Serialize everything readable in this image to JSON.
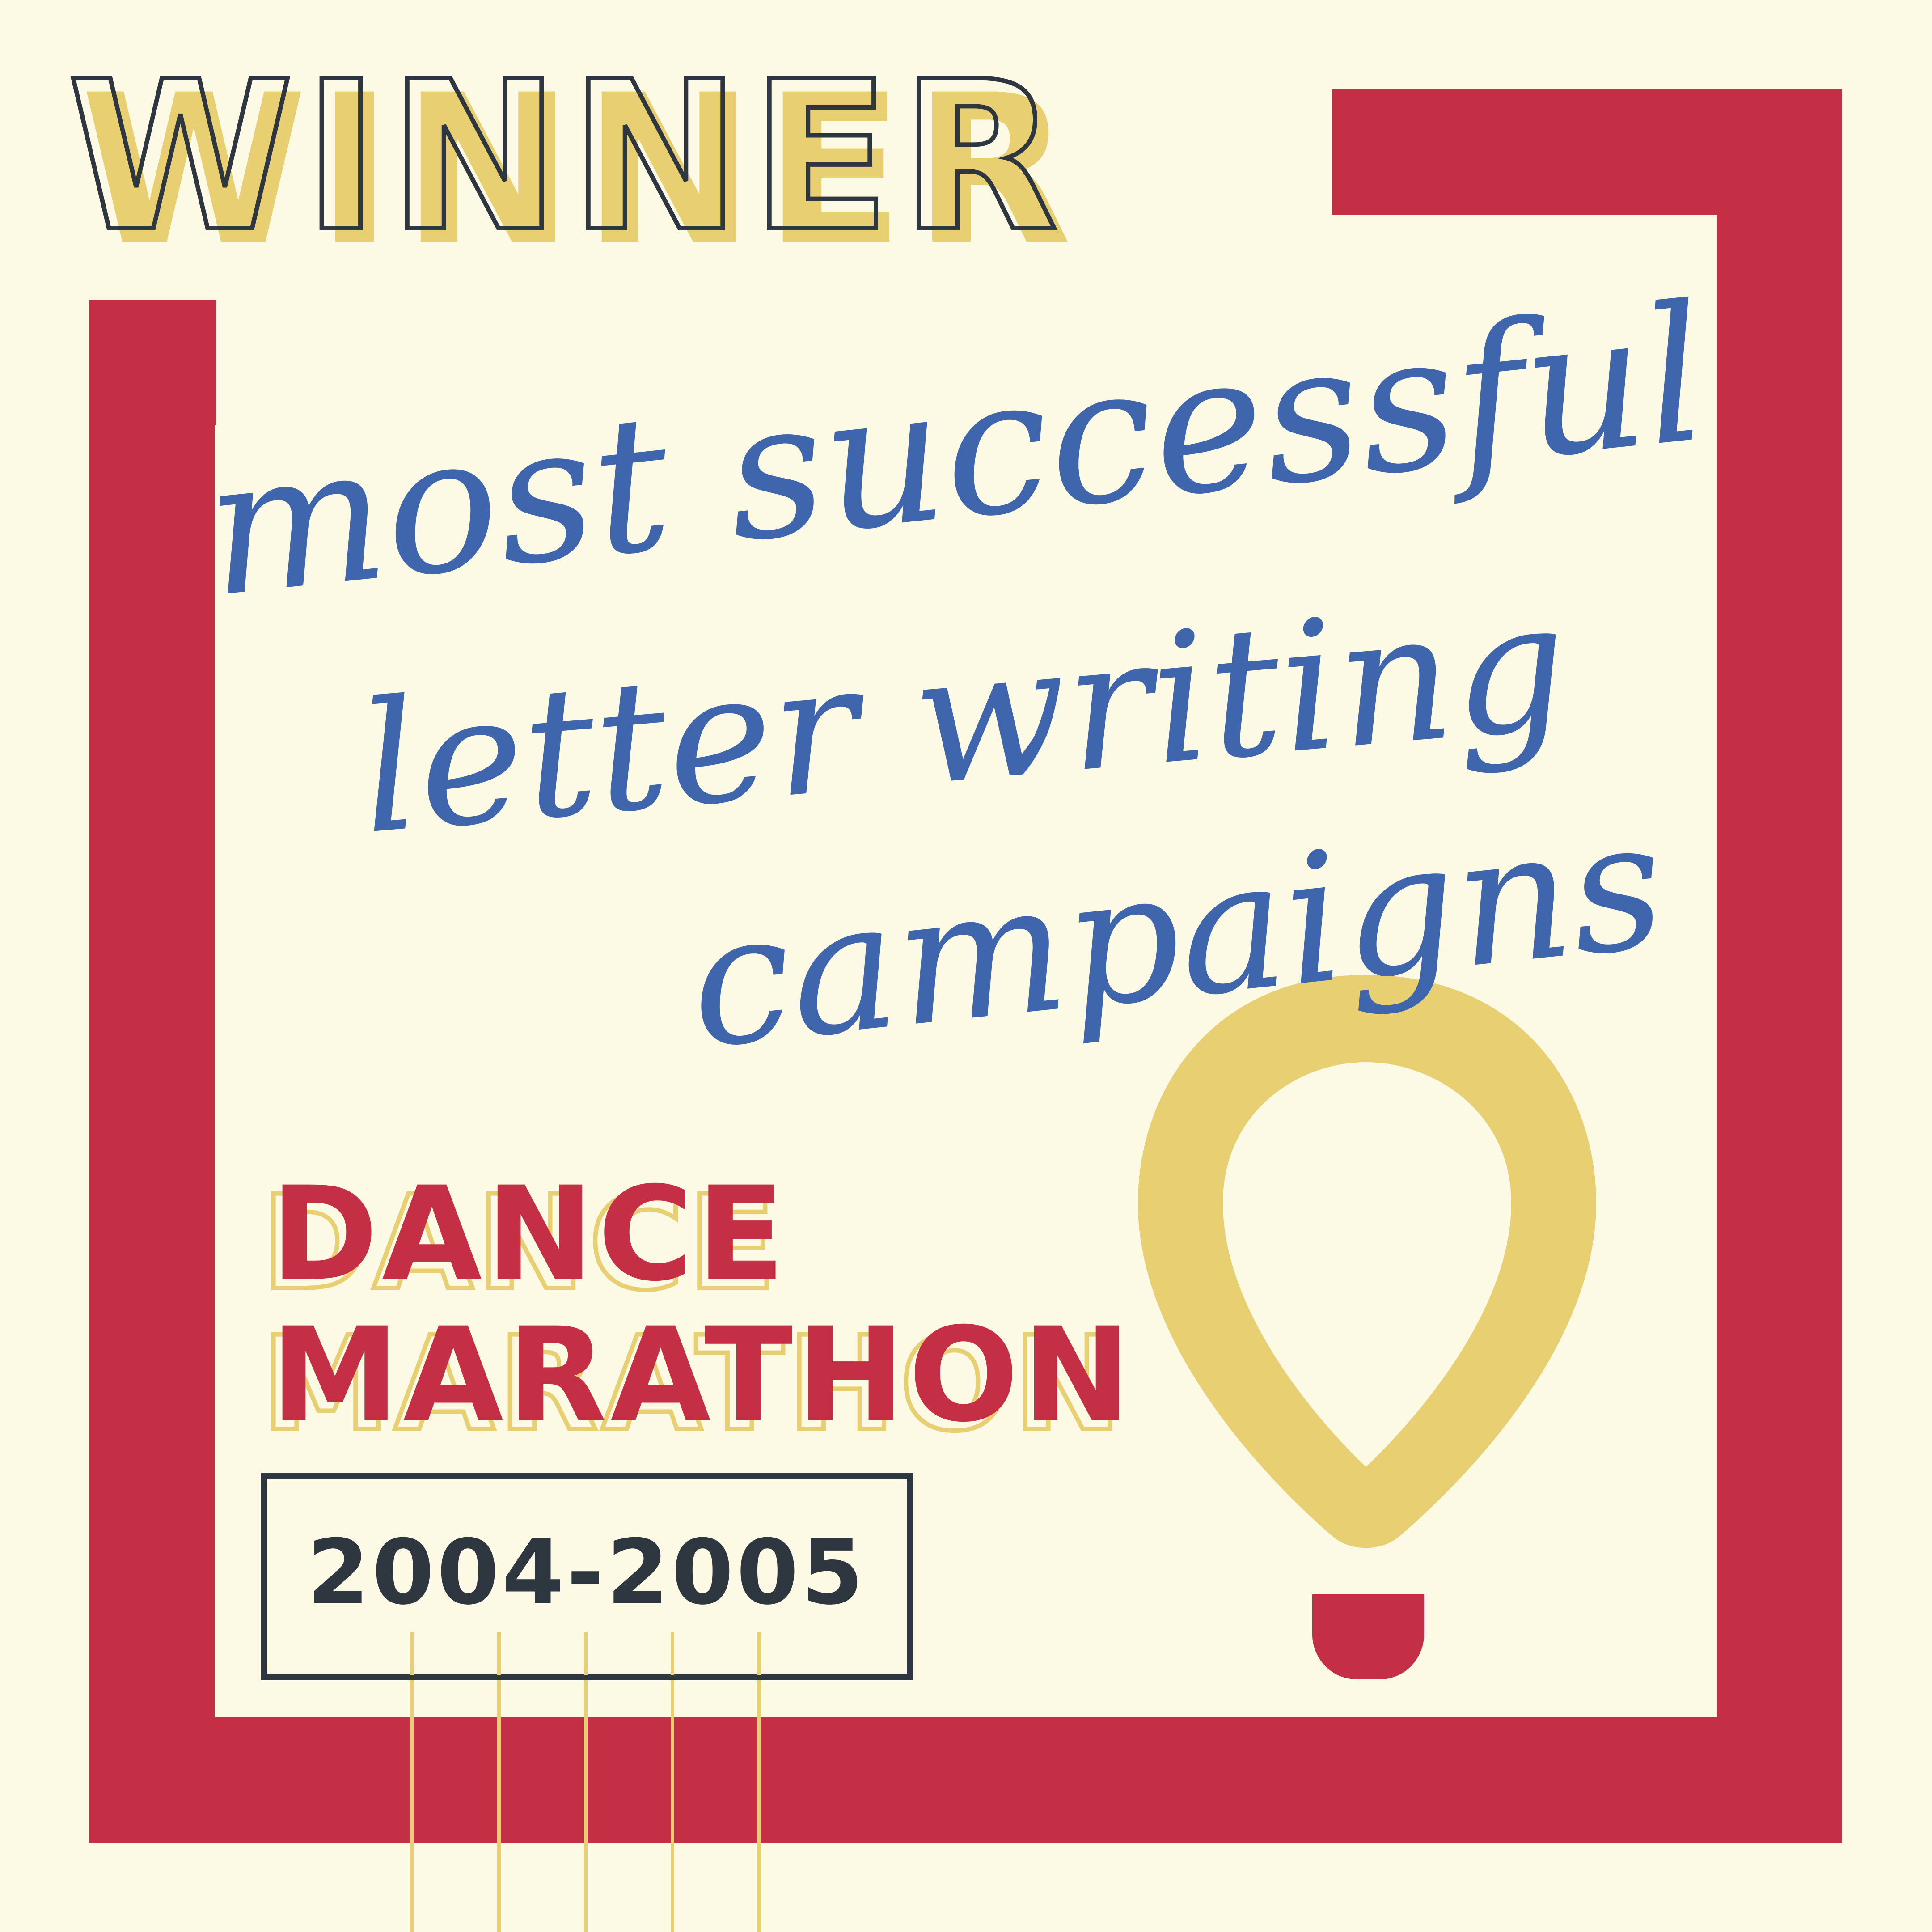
{
  "badge": {
    "winner_word": "WINNER",
    "award_line_1": "most successful",
    "award_line_2": "letter writing",
    "award_line_3": "campaigns",
    "event_line_1": "DANCE",
    "event_line_2": "MARATHON",
    "years": "2004-2005"
  },
  "colors": {
    "background": "#fcf9e4",
    "frame_red": "#c42f46",
    "gold": "#e8cf72",
    "script_blue": "#3f66ad",
    "dark": "#2e3640",
    "outline_fill": "#fcf9e4"
  },
  "icons": {
    "balloon": "hot-air-balloon-icon"
  }
}
